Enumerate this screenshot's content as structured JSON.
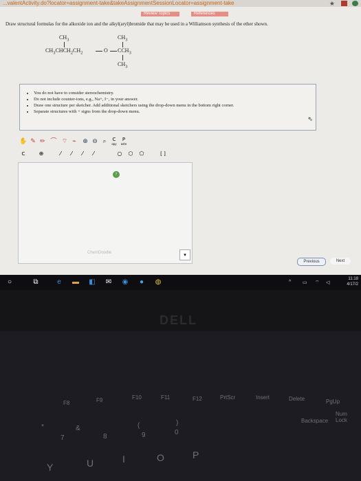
{
  "browser": {
    "url": "...valentActivity.do?locator=assignment-take&takeAssignmentSessionLocator=assignment-take",
    "star_icon": "star-icon"
  },
  "top_buttons": {
    "review_topics": "Review Topics",
    "references": "References"
  },
  "question": {
    "text": "Draw structural formulas for the alkoxide ion and the alkyl(aryl)bromide that may be used in a Williamson synthesis of the ether shown.",
    "molecule": {
      "left_top": "CH3",
      "left_chain": "CH3CHCH2CH2",
      "oxygen": "O",
      "right_top": "CH3",
      "right_mid": "CCH3",
      "right_bottom": "CH3"
    }
  },
  "instructions": [
    "You do not have to consider stereochemistry.",
    "Do not include counter-ions, e.g., Na+, I−, in your answer.",
    "Draw one structure per sketcher. Add additional sketchers using the drop-down menu in the bottom right corner.",
    "Separate structures with + signs from the drop-down menu."
  ],
  "sketcher": {
    "watermark": "ChemDoodle",
    "toolbar_row1": [
      "hand-icon",
      "eraser-icon",
      "pencil-icon",
      "ring-icon",
      "zoom-in-icon",
      "zoom-out-icon",
      "wand-icon",
      "copy-label",
      "paste-label"
    ],
    "toolbar_row1_labels": {
      "copy": "C",
      "copy_sub": "opy",
      "paste": "P",
      "paste_sub": "aste"
    },
    "toolbar_row2": [
      "C",
      "⊕",
      "⁄",
      "⁄",
      "⁄",
      "⁄",
      "○",
      "⬡",
      "⬠",
      "[ ]"
    ]
  },
  "nav": {
    "previous": "Previous",
    "next": "Next"
  },
  "taskbar": {
    "time": "11:18",
    "date": "4/17/2"
  },
  "laptop": {
    "brand": "DELL",
    "keys": [
      "F8",
      "F9",
      "F10",
      "F11",
      "F12",
      "PrtScr",
      "Insert",
      "Delete",
      "PgUp",
      "Backspace",
      "Num Lock",
      "*",
      "&",
      "(",
      ")",
      "7",
      "8",
      "9",
      "0",
      "Y",
      "U",
      "I",
      "O",
      "P"
    ]
  }
}
